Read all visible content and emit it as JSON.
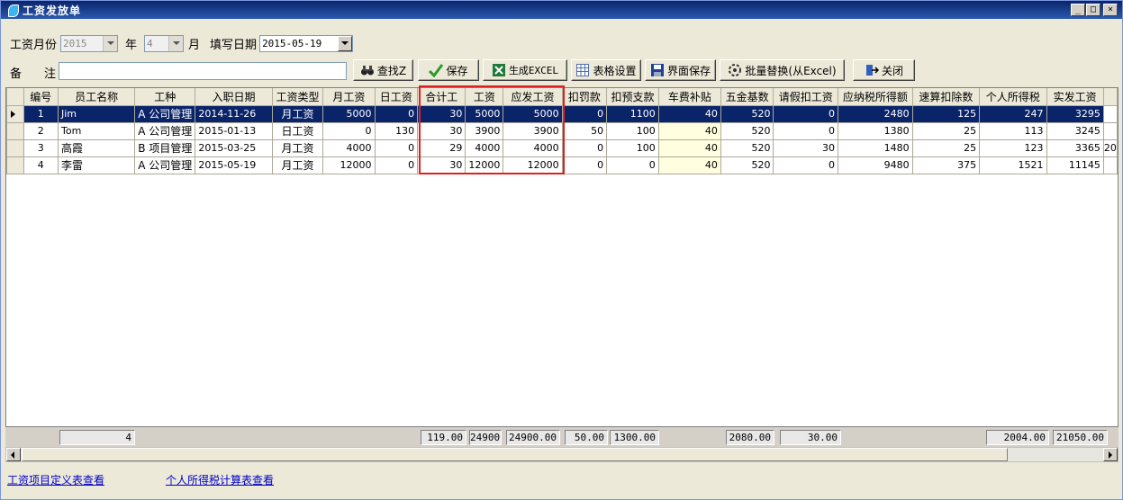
{
  "window": {
    "title": "工资发放单",
    "min": "_",
    "max": "□",
    "close": "×"
  },
  "filters": {
    "salary_month_label": "工资月份",
    "year_value": "2015",
    "year_label": "年",
    "month_value": "4",
    "month_label": "月",
    "fill_date_label": "填写日期",
    "fill_date_value": "2015-05-19",
    "remark_label_1": "备",
    "remark_label_2": "注",
    "remark_value": ""
  },
  "toolbar": {
    "find": "查找Z",
    "save": "保存",
    "excel": "生成EXCEL",
    "table_settings": "表格设置",
    "save_layout": "界面保存",
    "batch_replace": "批量替换(从Excel)",
    "close": "关闭"
  },
  "grid": {
    "columns": [
      "编号",
      "员工名称",
      "工种",
      "入职日期",
      "工资类型",
      "月工资",
      "日工资",
      "合计工",
      "工资",
      "应发工资",
      "扣罚款",
      "扣预支款",
      "车费补贴",
      "五金基数",
      "请假扣工资",
      "应纳税所得额",
      "速算扣除数",
      "个人所得税",
      "实发工资"
    ],
    "rows": [
      [
        "1",
        "Jim",
        "A 公司管理",
        "2014-11-26",
        "月工资",
        "5000",
        "0",
        "30",
        "5000",
        "5000",
        "0",
        "1100",
        "40",
        "520",
        "0",
        "2480",
        "125",
        "247",
        "3295"
      ],
      [
        "2",
        "Tom",
        "A 公司管理",
        "2015-01-13",
        "日工资",
        "0",
        "130",
        "30",
        "3900",
        "3900",
        "50",
        "100",
        "40",
        "520",
        "0",
        "1380",
        "25",
        "113",
        "3245"
      ],
      [
        "3",
        "高霞",
        "B 项目管理",
        "2015-03-25",
        "月工资",
        "4000",
        "0",
        "29",
        "4000",
        "4000",
        "0",
        "100",
        "40",
        "520",
        "30",
        "1480",
        "25",
        "123",
        "3365"
      ],
      [
        "4",
        "李雷",
        "A 公司管理",
        "2015-05-19",
        "月工资",
        "12000",
        "0",
        "30",
        "12000",
        "12000",
        "0",
        "0",
        "40",
        "520",
        "0",
        "9480",
        "375",
        "1521",
        "11145"
      ]
    ],
    "overflow_cell": "20"
  },
  "totals": {
    "count": "4",
    "total_work": "119.00",
    "salary": "24900",
    "payable": "24900.00",
    "fine": "50.00",
    "advance": "1300.00",
    "five_fund": "2080.00",
    "leave": "30.00",
    "tax": "2004.00",
    "net": "21050.00"
  },
  "links": {
    "salary_items": "工资项目定义表查看",
    "tax_table": "个人所得税计算表查看"
  },
  "colors": {
    "title_bar": "#0a246a",
    "selected_row": "#0a246a",
    "highlight_box": "#e02020",
    "link": "#0000cc"
  }
}
